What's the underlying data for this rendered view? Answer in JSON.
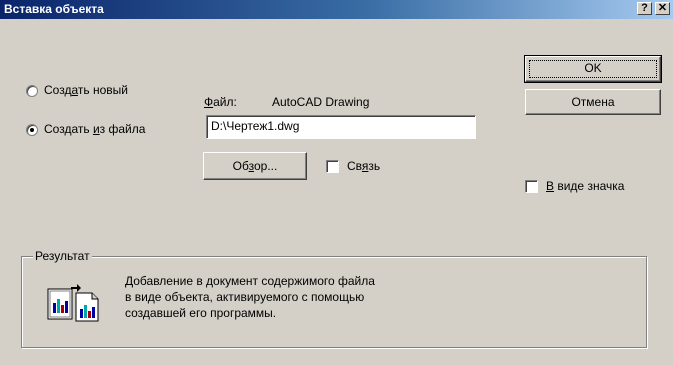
{
  "window": {
    "title": "Вставка объекта",
    "help_label": "?",
    "close_label": "✕"
  },
  "options": {
    "create_new": {
      "prefix": "Созд",
      "accel": "а",
      "suffix": "ть новый"
    },
    "create_from_file": {
      "prefix": "Создать ",
      "accel": "и",
      "suffix": "з файла",
      "selected": true
    }
  },
  "file": {
    "label_accel": "Ф",
    "label_rest": "айл:",
    "type": "AutoCAD Drawing",
    "path": "D:\\Чертеж1.dwg"
  },
  "browse_button": {
    "prefix": "Об",
    "accel": "з",
    "suffix": "ор..."
  },
  "link_checkbox": {
    "prefix": "Св",
    "accel": "я",
    "suffix": "зь",
    "checked": false
  },
  "ok_button": {
    "label": "OK"
  },
  "cancel_button": {
    "label": "Отмена"
  },
  "as_icon_checkbox": {
    "accel": "В",
    "suffix": " виде значка",
    "checked": false
  },
  "result": {
    "legend": "Результат",
    "line1": "Добавление в документ содержимого файла",
    "line2": "в виде объекта, активируемого с помощью",
    "line3": "создавшей его программы."
  }
}
